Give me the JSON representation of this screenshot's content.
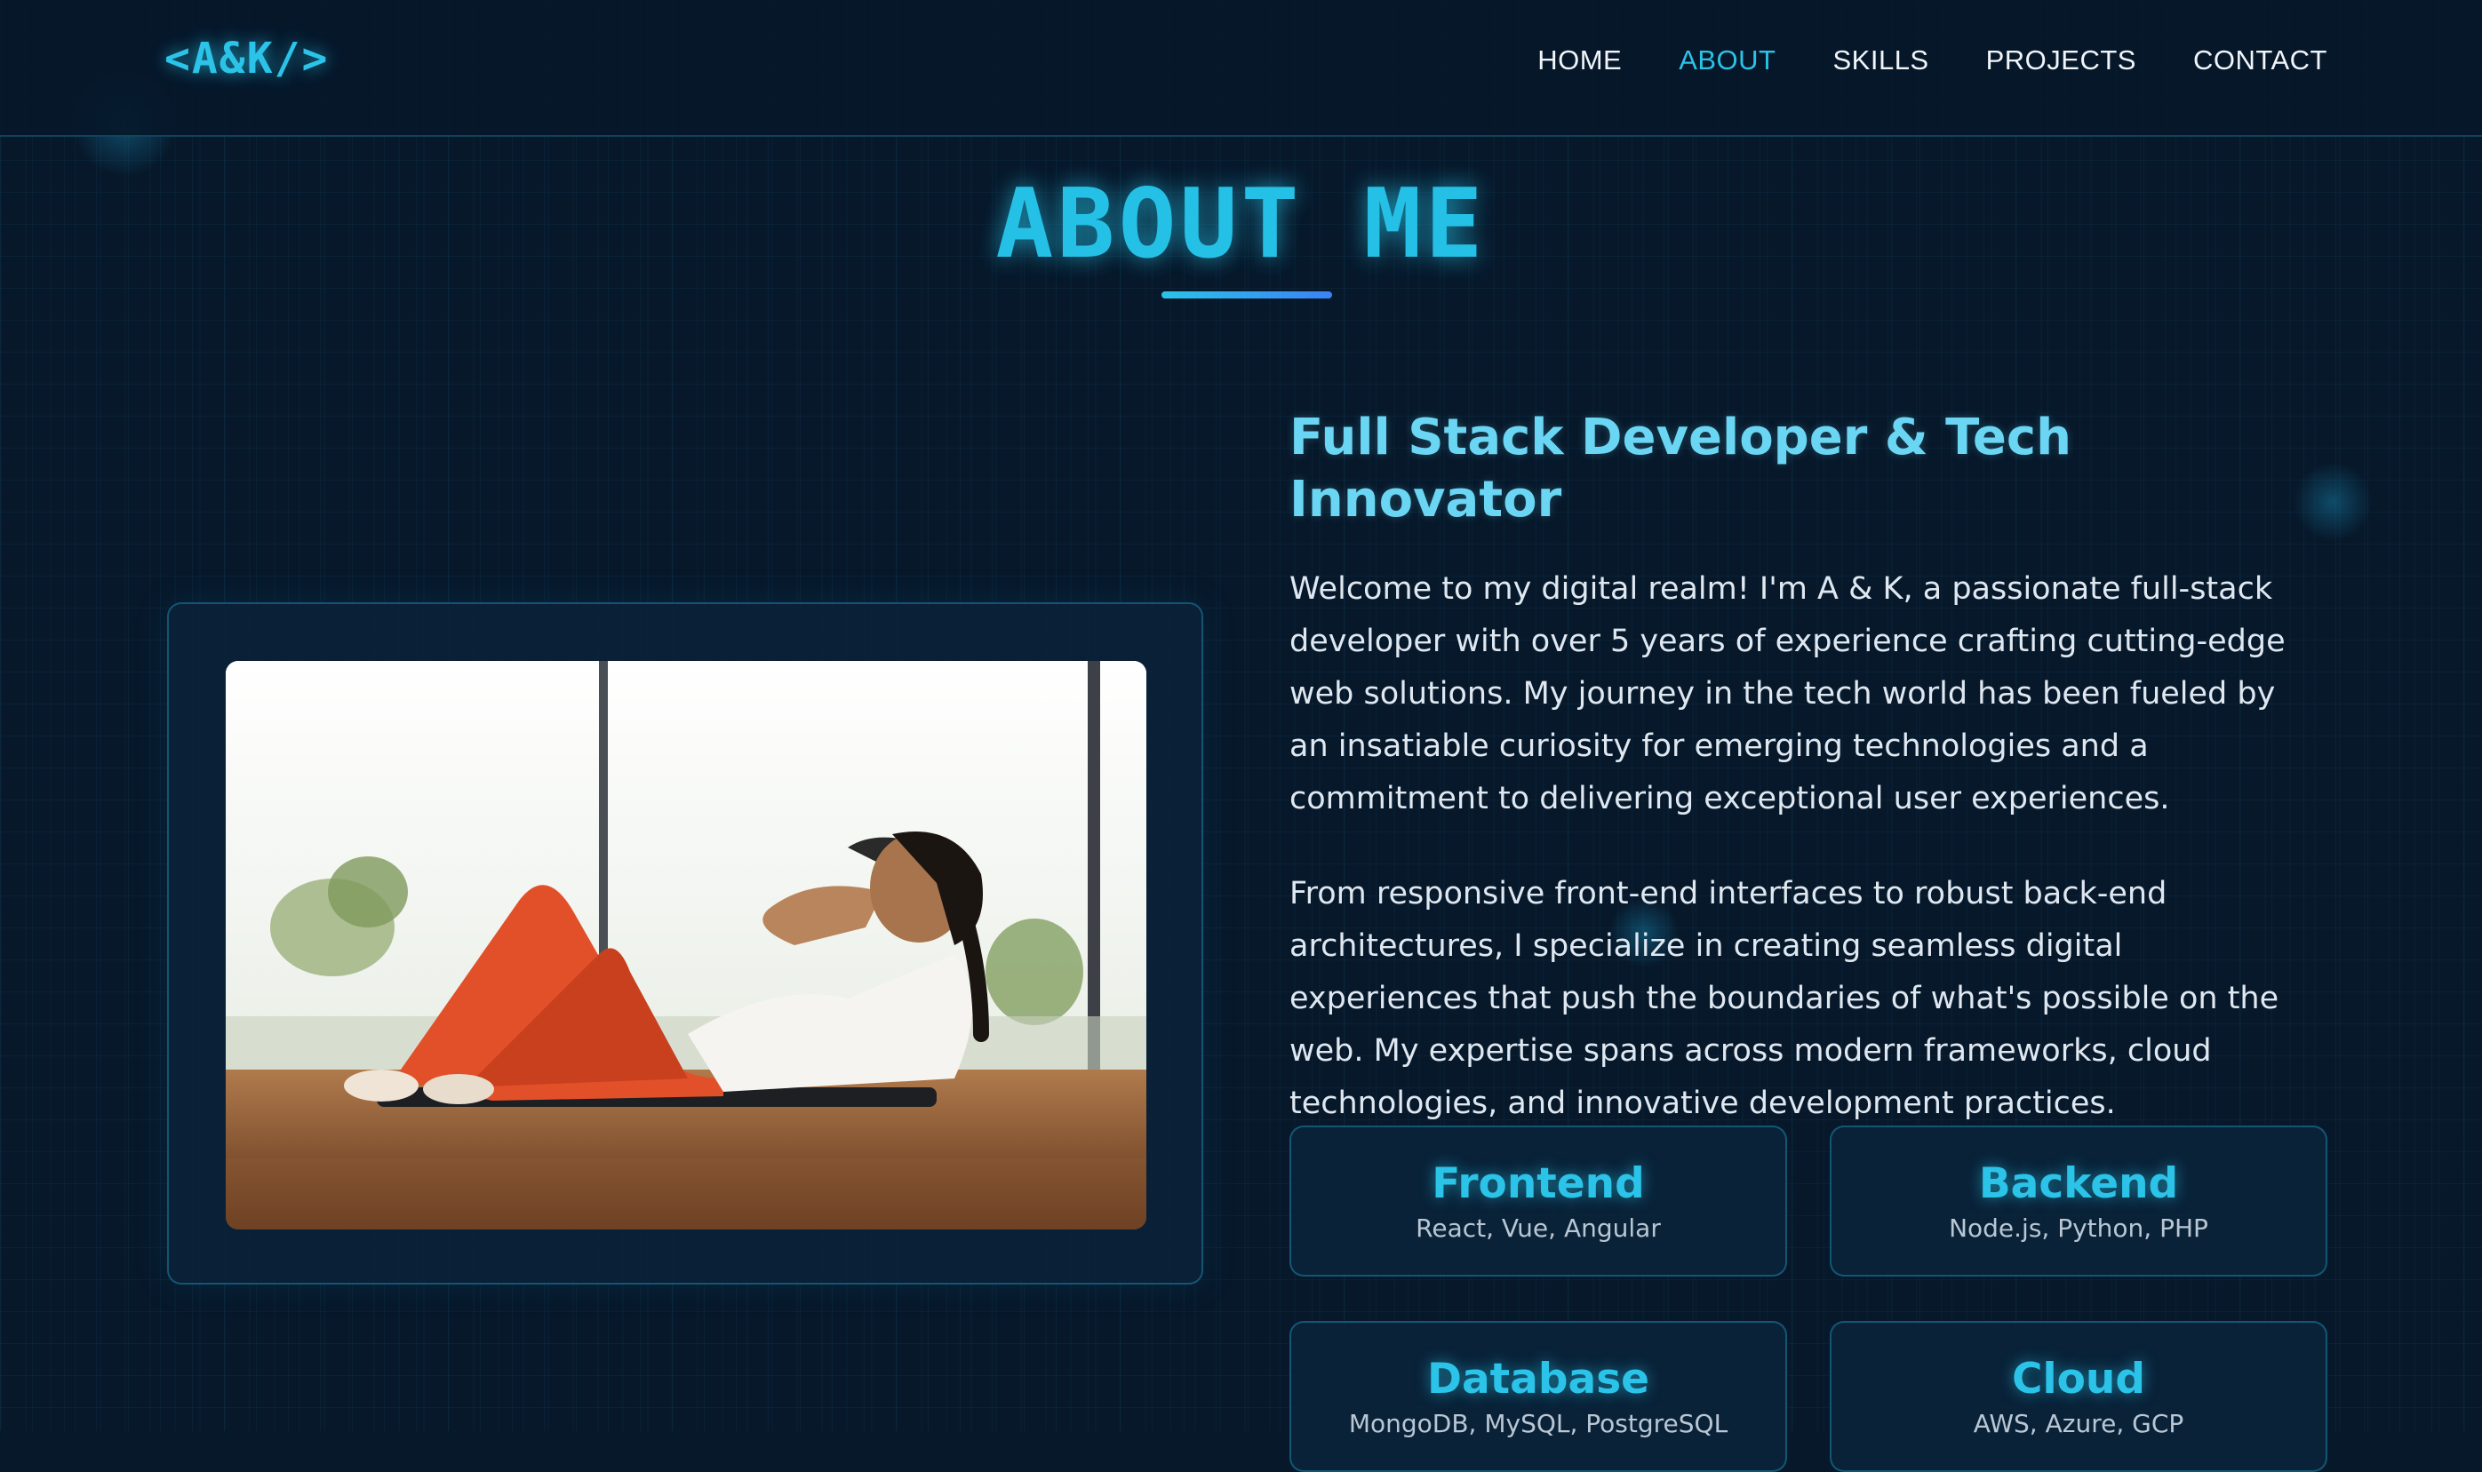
{
  "logo": "<A&K/>",
  "nav": {
    "items": [
      {
        "label": "HOME"
      },
      {
        "label": "ABOUT"
      },
      {
        "label": "SKILLS"
      },
      {
        "label": "PROJECTS"
      },
      {
        "label": "CONTACT"
      }
    ],
    "active": "ABOUT"
  },
  "about": {
    "title": "ABOUT ME",
    "subtitle": "Full Stack Developer & Tech Innovator",
    "paragraphs": [
      "Welcome to my digital realm! I'm A & K, a passionate full-stack developer with over 5 years of experience crafting cutting-edge web solutions. My journey in the tech world has been fueled by an insatiable curiosity for emerging technologies and a commitment to delivering exceptional user experiences.",
      "From responsive front-end interfaces to robust back-end architectures, I specialize in creating seamless digital experiences that push the boundaries of what's possible on the web. My expertise spans across modern frameworks, cloud technologies, and innovative development practices."
    ],
    "cards": [
      {
        "title": "Frontend",
        "desc": "React, Vue, Angular"
      },
      {
        "title": "Backend",
        "desc": "Node.js, Python, PHP"
      },
      {
        "title": "Database",
        "desc": "MongoDB, MySQL, PostgreSQL"
      },
      {
        "title": "Cloud",
        "desc": "AWS, Azure, GCP"
      }
    ]
  },
  "colors": {
    "accent": "#2bc3e8",
    "background": "#07182a",
    "text": "#dfe8f1"
  }
}
